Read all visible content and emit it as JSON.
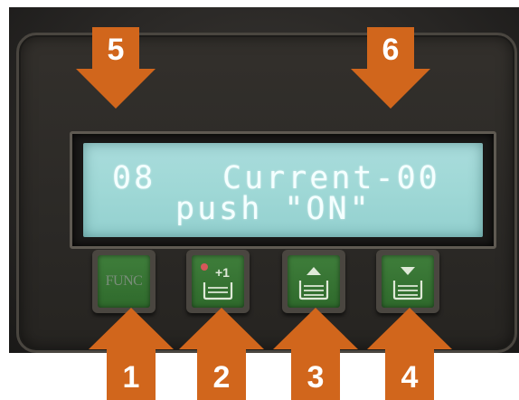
{
  "display": {
    "line1_left": "08",
    "line1_right": "Current-00",
    "line2": "push \"ON\""
  },
  "buttons": {
    "func": {
      "label": "FUNC",
      "icon": "func-text"
    },
    "plus_one": {
      "label": "+1",
      "icon": "basin-plus-one-icon"
    },
    "up": {
      "icon": "basin-up-arrow-icon"
    },
    "down": {
      "icon": "basin-down-arrow-icon"
    }
  },
  "callouts": {
    "top": [
      "5",
      "6"
    ],
    "bottom": [
      "1",
      "2",
      "3",
      "4"
    ],
    "color": "#d1661c"
  },
  "colors": {
    "lcd_background": "#9fd8d6",
    "lcd_text": "#f4ffff",
    "button_green": "#3a7a37",
    "panel": "#2b2926"
  }
}
